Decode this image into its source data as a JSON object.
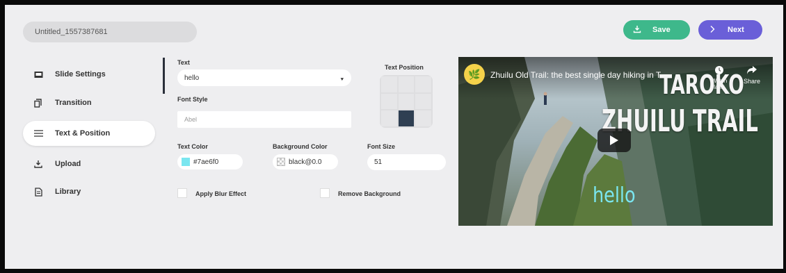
{
  "project": {
    "title": "Untitled_1557387681"
  },
  "actions": {
    "save_label": "Save",
    "next_label": "Next"
  },
  "sidebar": {
    "items": [
      {
        "label": "Slide Settings",
        "icon": "slide-icon"
      },
      {
        "label": "Transition",
        "icon": "copy-icon"
      },
      {
        "label": "Text & Position",
        "icon": "menu-icon",
        "active": true
      },
      {
        "label": "Upload",
        "icon": "download-icon"
      },
      {
        "label": "Library",
        "icon": "document-icon"
      }
    ]
  },
  "editor": {
    "text_label": "Text",
    "text_value": "hello",
    "font_style_label": "Font Style",
    "font_style_placeholder": "Abel",
    "text_position_label": "Text Position",
    "text_color_label": "Text Color",
    "text_color_value": "#7ae6f0",
    "background_color_label": "Background Color",
    "background_color_value": "black@0.0",
    "font_size_label": "Font Size",
    "font_size_value": "51",
    "blur_label": "Apply Blur Effect",
    "remove_bg_label": "Remove Background"
  },
  "preview": {
    "video_title": "Zhuilu Old Trail: the best single day hiking in T...",
    "watch_later": "Watch later",
    "share": "Share",
    "overlay_line1": "TAROKO",
    "overlay_line2": "ZHUILU TRAIL",
    "overlay_text": "hello"
  },
  "colors": {
    "save": "#3eb88b",
    "next": "#6a5fd8",
    "text_color": "#7ae6f0"
  }
}
